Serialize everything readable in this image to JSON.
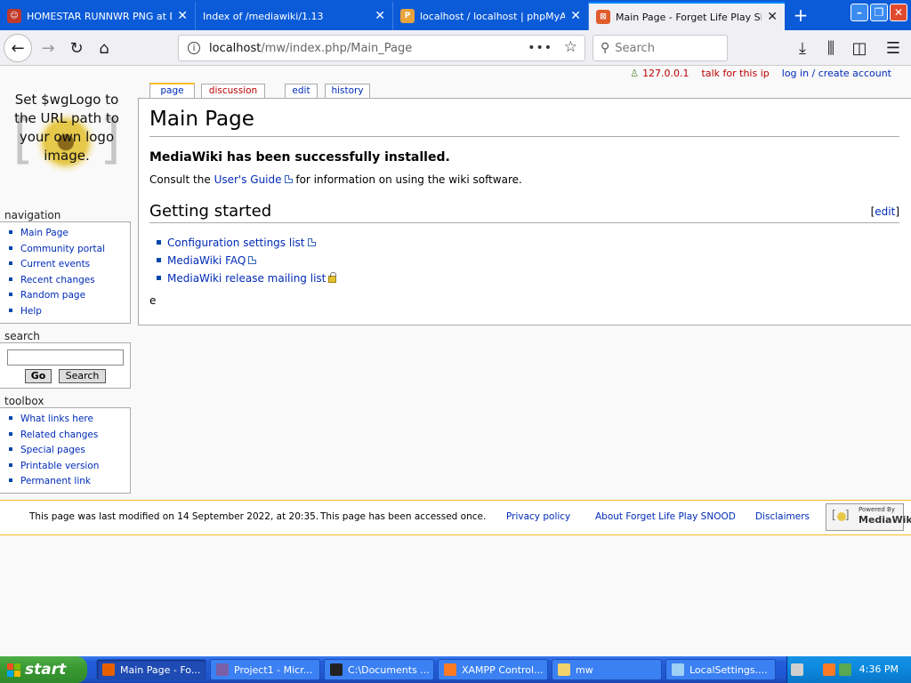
{
  "browser": {
    "tabs": [
      {
        "title": "HOMESTAR RUNNWR PNG at Dur",
        "icon": "homestar-favicon-icon",
        "active": false
      },
      {
        "title": "Index of /mediawiki/1.13",
        "icon": "blank-page-icon",
        "active": false
      },
      {
        "title": "localhost / localhost | phpMyAdm",
        "icon": "phpmyadmin-favicon-icon",
        "active": false
      },
      {
        "title": "Main Page - Forget Life Play SNOO",
        "icon": "xampp-favicon-icon",
        "active": true
      }
    ],
    "url_host": "localhost",
    "url_path": "/mw/index.php/Main_Page",
    "search_placeholder": "Search"
  },
  "wiki": {
    "personal": {
      "ip": "127.0.0.1",
      "talk": "talk for this ip",
      "login": "log in / create account"
    },
    "logo_text": "Set $wgLogo to the URL path to your own logo image.",
    "tabs": {
      "page": "page",
      "discussion": "discussion",
      "edit": "edit",
      "history": "history"
    },
    "navigation": {
      "title": "navigation",
      "items": [
        "Main Page",
        "Community portal",
        "Current events",
        "Recent changes",
        "Random page",
        "Help"
      ]
    },
    "search": {
      "title": "search",
      "go": "Go",
      "search": "Search"
    },
    "toolbox": {
      "title": "toolbox",
      "items": [
        "What links here",
        "Related changes",
        "Special pages",
        "Printable version",
        "Permanent link"
      ]
    },
    "content": {
      "heading": "Main Page",
      "success": "MediaWiki has been successfully installed.",
      "consult_prefix": "Consult the",
      "consult_link": "User's Guide",
      "consult_suffix": "for information on using the wiki software.",
      "section_heading": "Getting started",
      "edit_open": "[",
      "edit_label": "edit",
      "edit_close": "]",
      "links": [
        "Configuration settings list",
        "MediaWiki FAQ",
        "MediaWiki release mailing list"
      ],
      "stray_text": "e"
    },
    "footer": {
      "lastmod": "This page was last modified on 14 September 2022, at 20:35.",
      "accessed": "This page has been accessed once.",
      "privacy": "Privacy policy",
      "about": "About Forget Life Play SNOOD",
      "disclaimers": "Disclaimers",
      "powered_small": "Powered By",
      "powered_big": "MediaWiki"
    }
  },
  "taskbar": {
    "start": "start",
    "tasks": [
      {
        "label": "Main Page - Fo...",
        "icon": "firefox-icon",
        "active": true
      },
      {
        "label": "Project1 - Micr...",
        "icon": "visual-basic-icon",
        "active": false
      },
      {
        "label": "C:\\Documents ...",
        "icon": "7zip-icon",
        "active": false
      },
      {
        "label": "XAMPP Control...",
        "icon": "xampp-icon",
        "active": false
      },
      {
        "label": "mw",
        "icon": "folder-icon",
        "active": false
      },
      {
        "label": "LocalSettings....",
        "icon": "notepad-icon",
        "active": false
      }
    ],
    "clock": "4:36 PM"
  },
  "colors": {
    "tab_strip": "#0b5bd8",
    "link": "#002bb8",
    "new_link": "#ba0000",
    "footer_border": "#fabd23",
    "taskbar": "#245edb",
    "start": "#3a9a33"
  }
}
